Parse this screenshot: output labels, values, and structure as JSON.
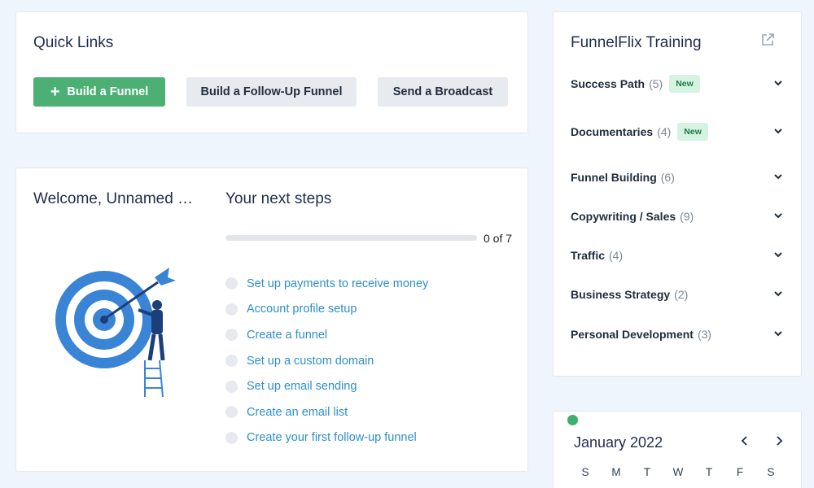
{
  "quick_links": {
    "title": "Quick Links",
    "build_funnel": "Build a Funnel",
    "build_follow_up": "Build a Follow-Up Funnel",
    "send_broadcast": "Send a Broadcast"
  },
  "welcome": {
    "title": "Welcome, Unnamed …",
    "next_steps_title": "Your next steps",
    "progress_text": "0 of 7",
    "progress_fraction": 0,
    "steps": [
      "Set up payments to receive money",
      "Account profile setup",
      "Create a funnel",
      "Set up a custom domain",
      "Set up email sending",
      "Create an email list",
      "Create your first follow-up funnel"
    ]
  },
  "training": {
    "title": "FunnelFlix Training",
    "items": [
      {
        "name": "Success Path",
        "count": "(5)",
        "badge": "New"
      },
      {
        "name": "Documentaries",
        "count": "(4)",
        "badge": "New"
      },
      {
        "name": "Funnel Building",
        "count": "(6)",
        "badge": ""
      },
      {
        "name": "Copywriting / Sales",
        "count": "(9)",
        "badge": ""
      },
      {
        "name": "Traffic",
        "count": "(4)",
        "badge": ""
      },
      {
        "name": "Business Strategy",
        "count": "(2)",
        "badge": ""
      },
      {
        "name": "Personal Development",
        "count": "(3)",
        "badge": ""
      }
    ]
  },
  "calendar": {
    "month": "January 2022",
    "weekdays": [
      "S",
      "M",
      "T",
      "W",
      "T",
      "F",
      "S"
    ]
  },
  "colors": {
    "accent_green": "#4caf74",
    "link_blue": "#2e8fc9",
    "badge_bg": "#d6f3e2"
  },
  "icons": {
    "plus": "plus-icon",
    "external": "external-link-icon",
    "chevron": "chevron-down-icon",
    "prev": "chevron-left-icon",
    "next": "chevron-right-icon"
  }
}
